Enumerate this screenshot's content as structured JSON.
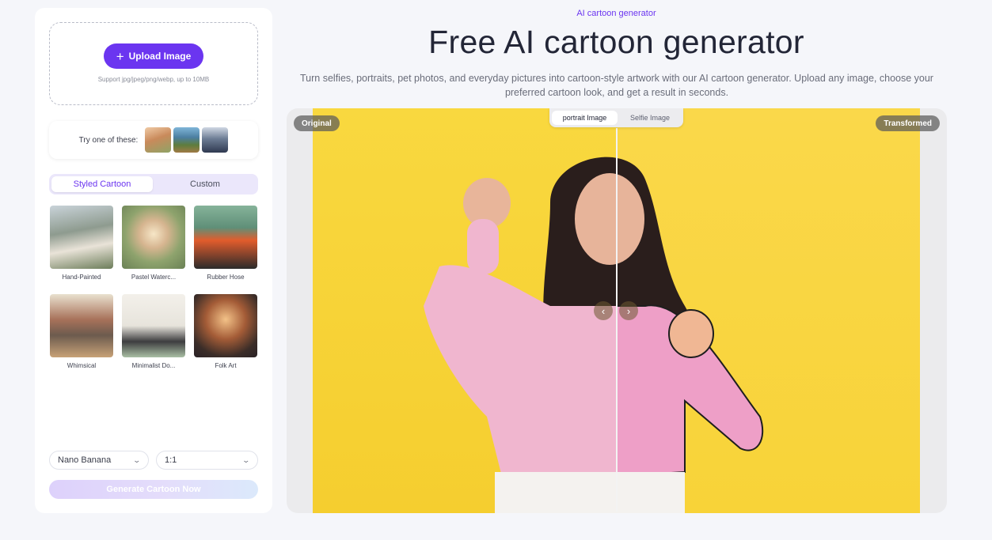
{
  "sidebar": {
    "upload": {
      "button_label": "Upload Image",
      "hint": "Support jpg/jpeg/png/webp, up to 10MB"
    },
    "try": {
      "label": "Try one of these:",
      "samples": [
        "sample-portrait",
        "sample-landscape",
        "sample-group"
      ]
    },
    "tabs": [
      {
        "label": "Styled Cartoon",
        "active": true
      },
      {
        "label": "Custom",
        "active": false
      }
    ],
    "styles": [
      {
        "label": "Hand-Painted"
      },
      {
        "label": "Pastel Waterc..."
      },
      {
        "label": "Rubber Hose"
      },
      {
        "label": "Whimsical"
      },
      {
        "label": "Minimalist Do..."
      },
      {
        "label": "Folk Art"
      }
    ],
    "model_select": {
      "value": "Nano Banana"
    },
    "ratio_select": {
      "value": "1:1"
    },
    "generate_label": "Generate Cartoon Now"
  },
  "main": {
    "eyebrow": "AI cartoon generator",
    "title": "Free AI cartoon generator",
    "description": "Turn selfies, portraits, pet photos, and everyday pictures into cartoon-style artwork with our AI cartoon generator. Upload any image, choose your preferred cartoon look, and get a result in seconds.",
    "compare": {
      "original_label": "Original",
      "transformed_label": "Transformed",
      "tabs": [
        {
          "label": "portrait Image",
          "active": true
        },
        {
          "label": "Selfie Image",
          "active": false
        }
      ]
    }
  },
  "colors": {
    "accent": "#6b35f0",
    "background": "#f5f6fa",
    "photo_bg": "#f8d53d"
  },
  "icons": {
    "upload": "plus-icon",
    "prev": "chevron-left-icon",
    "next": "chevron-right-icon",
    "dropdown": "chevron-down-icon"
  }
}
